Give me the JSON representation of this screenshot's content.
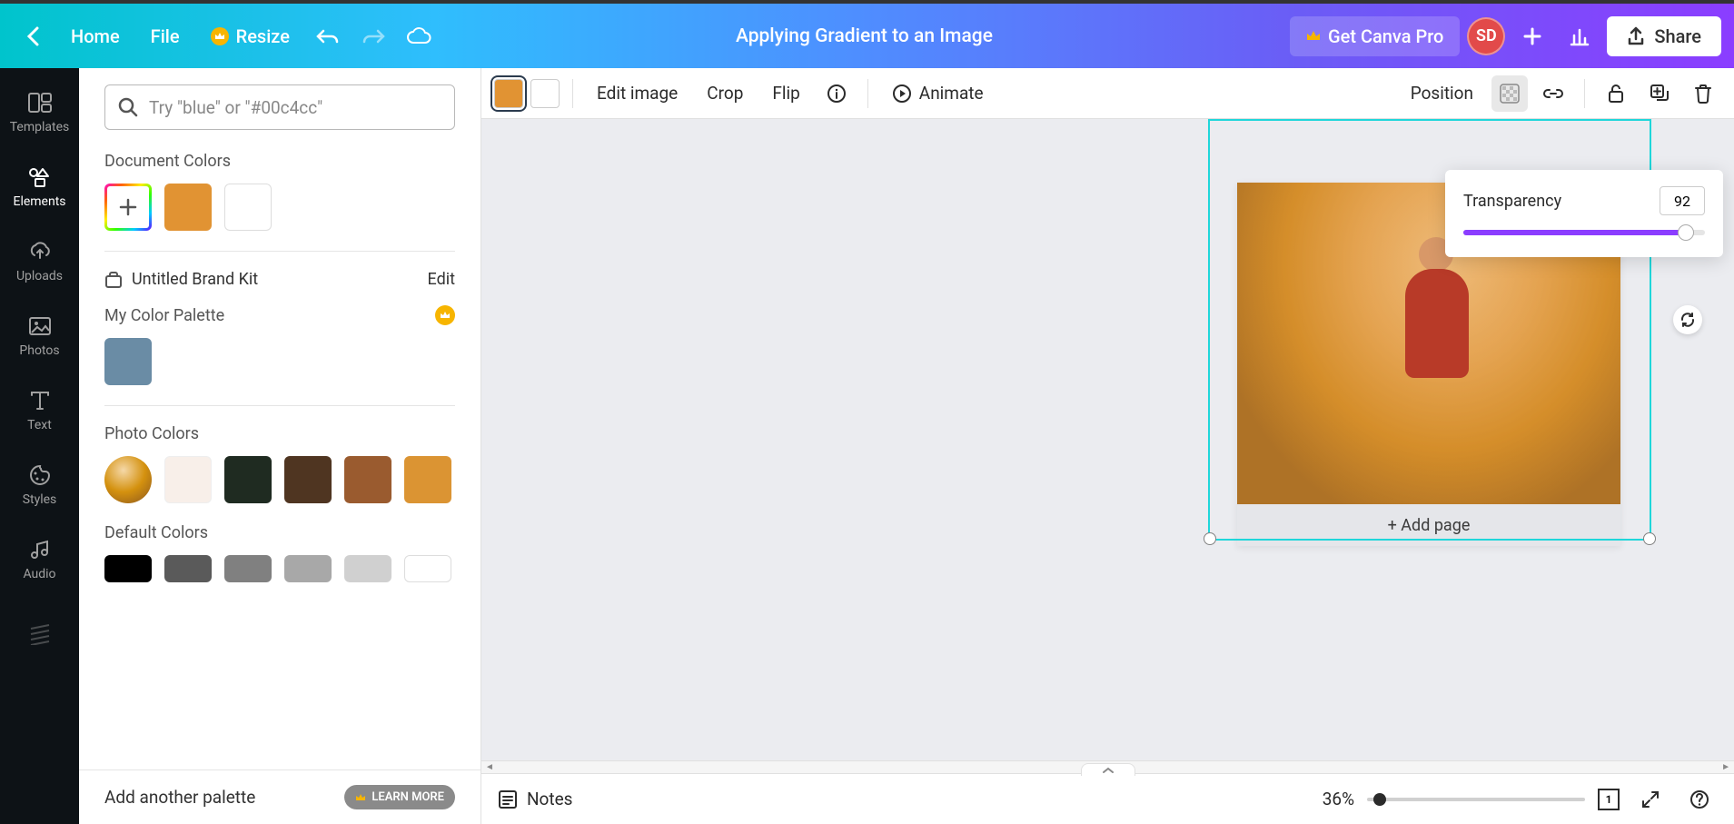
{
  "header": {
    "home": "Home",
    "file": "File",
    "resize": "Resize",
    "doc_title": "Applying Gradient to an Image",
    "get_pro": "Get Canva Pro",
    "avatar": "SD",
    "share": "Share"
  },
  "nav": {
    "templates": "Templates",
    "elements": "Elements",
    "uploads": "Uploads",
    "photos": "Photos",
    "text": "Text",
    "styles": "Styles",
    "audio": "Audio"
  },
  "panel": {
    "search_placeholder": "Try \"blue\" or \"#00c4cc\"",
    "doc_colors_title": "Document Colors",
    "brand_kit": "Untitled Brand Kit",
    "edit": "Edit",
    "my_palette": "My Color Palette",
    "photo_colors": "Photo Colors",
    "default_colors": "Default Colors",
    "add_palette": "Add another palette",
    "learn_more": "LEARN MORE",
    "doc_swatches": [
      "#e19333",
      "#ffffff"
    ],
    "palette_swatches": [
      "#6a8ca5"
    ],
    "photo_swatches": [
      "#f8efe9",
      "#1f2b21",
      "#4f3521",
      "#9a5b2f",
      "#db9433"
    ],
    "default_swatches": [
      "#000000",
      "#5a5a5a",
      "#808080",
      "#a8a8a8",
      "#d0d0d0",
      "#ffffff"
    ]
  },
  "context": {
    "chip1": "#e19333",
    "chip2": "#ffffff",
    "edit_image": "Edit image",
    "crop": "Crop",
    "flip": "Flip",
    "animate": "Animate",
    "position": "Position"
  },
  "popover": {
    "label": "Transparency",
    "value": "92"
  },
  "canvas": {
    "add_page": "+ Add page"
  },
  "footer": {
    "notes": "Notes",
    "zoom": "36%",
    "page_num": "1"
  }
}
